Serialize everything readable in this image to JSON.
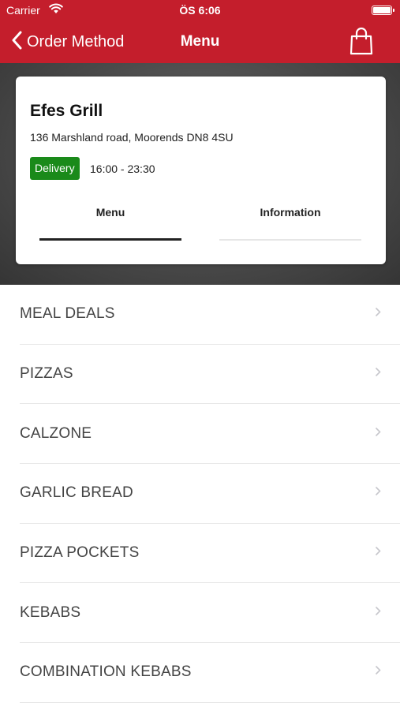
{
  "status_bar": {
    "carrier": "Carrier",
    "time": "ÖS 6:06"
  },
  "nav": {
    "back_label": "Order Method",
    "title": "Menu",
    "bag_icon": "shopping-bag-icon"
  },
  "restaurant": {
    "name": "Efes Grill",
    "address": "136 Marshland road, Moorends DN8 4SU",
    "badge": "Delivery",
    "hours": "16:00 - 23:30"
  },
  "tabs": [
    {
      "label": "Menu",
      "active": true
    },
    {
      "label": "Information",
      "active": false
    }
  ],
  "categories": [
    {
      "label": "MEAL DEALS"
    },
    {
      "label": "PIZZAS"
    },
    {
      "label": "CALZONE"
    },
    {
      "label": "GARLIC BREAD"
    },
    {
      "label": "PIZZA POCKETS"
    },
    {
      "label": "KEBABS"
    },
    {
      "label": "COMBINATION KEBABS"
    }
  ],
  "colors": {
    "header": "#c41e2c",
    "badge": "#1a8a1a",
    "text": "#444444"
  }
}
